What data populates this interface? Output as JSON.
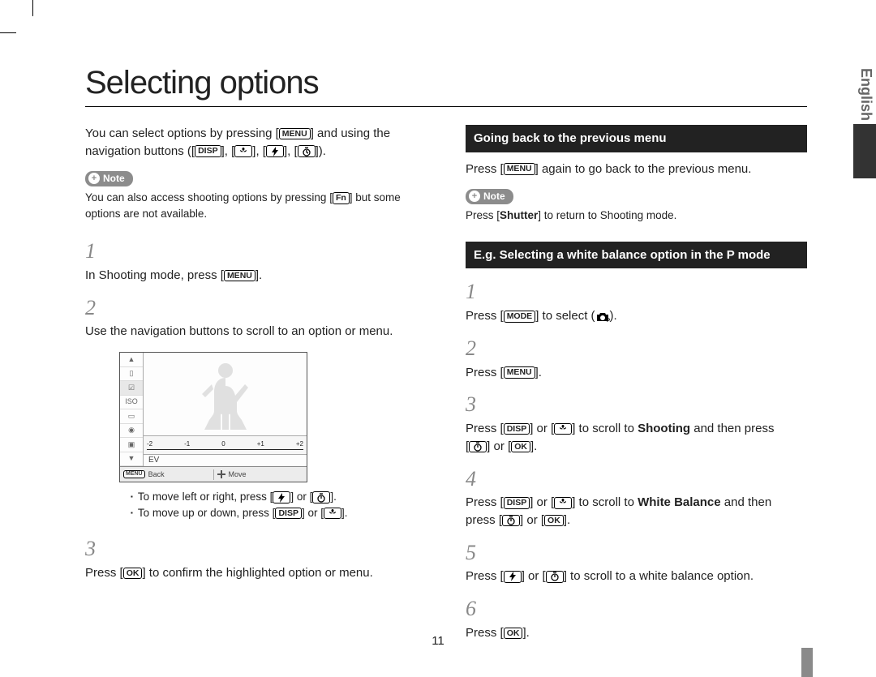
{
  "sideTabLabel": "English",
  "pageNumber": "11",
  "title": "Selecting options",
  "leftColumn": {
    "intro_a": "You can select options by pressing [",
    "intro_b": "] and using the navigation buttons ([",
    "intro_c": "], [",
    "intro_d": "], [",
    "intro_e": "], [",
    "intro_f": "]).",
    "menuPill": "MENU",
    "dispPill": "DISP",
    "noteLabel": "Note",
    "noteText_a": "You can also access shooting options by pressing [",
    "noteText_b": "] but some options are not available.",
    "fnPill": "Fn",
    "steps": {
      "s1_a": "In Shooting mode, press [",
      "s1_b": "].",
      "s2": "Use the navigation buttons to scroll to an option or menu.",
      "s3_a": "Press [",
      "s3_b": "] to confirm the highlighted option or menu.",
      "okPill": "OK"
    },
    "bullets": {
      "b1_a": "To move left or right, press [",
      "b1_b": "] or [",
      "b1_c": "].",
      "b2_a": "To move up or down, press [",
      "b2_b": "] or [",
      "b2_c": "]."
    },
    "screen": {
      "evTicks": [
        "-2",
        "-1",
        "0",
        "+1",
        "+2"
      ],
      "evLabel": "EV",
      "footerBackPill": "MENU",
      "footerBack": "Back",
      "footerMove": "Move"
    }
  },
  "rightColumn": {
    "section1": "Going back to the previous menu",
    "sec1_text_a": "Press [",
    "sec1_text_b": "] again to go back to the previous menu.",
    "noteLabel": "Note",
    "noteText_a": "Press [",
    "noteText_b": "] to return to Shooting mode.",
    "shutter": "Shutter",
    "section2": "E.g. Selecting a white balance option in the P mode",
    "steps": {
      "s1_a": "Press [",
      "s1_b": "] to select (",
      "s1_c": ").",
      "modePill": "MODE",
      "s2_a": "Press [",
      "s2_b": "].",
      "menuPill": "MENU",
      "s3_a": "Press [",
      "s3_b": "] or [",
      "s3_c": "] to scroll to ",
      "s3_bold": "Shooting",
      "s3_d": " and then press [",
      "s3_e": "] or [",
      "s3_f": "].",
      "dispPill": "DISP",
      "okPill": "OK",
      "s4_a": "Press [",
      "s4_b": "] or [",
      "s4_c": "] to scroll to ",
      "s4_bold": "White Balance",
      "s4_d": " and then press [",
      "s4_e": "] or [",
      "s4_f": "].",
      "s5_a": "Press [",
      "s5_b": "] or [",
      "s5_c": "] to scroll to a white balance option.",
      "s6_a": "Press [",
      "s6_b": "]."
    }
  }
}
